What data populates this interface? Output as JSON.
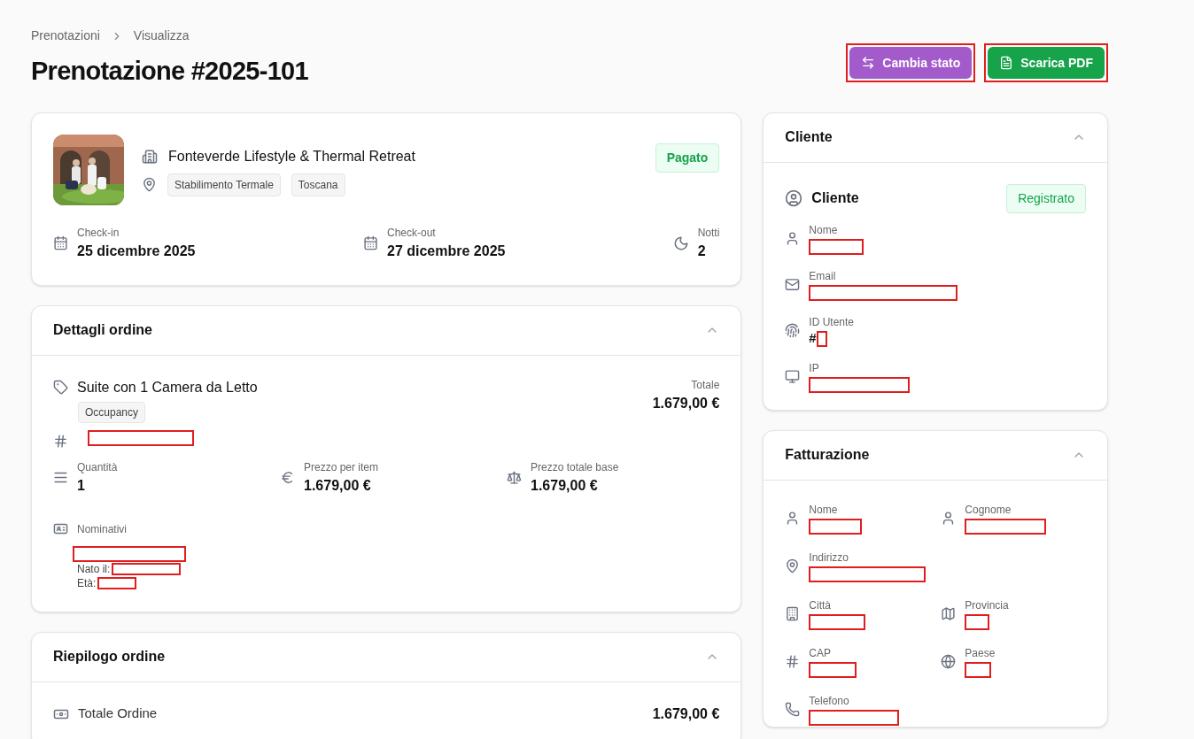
{
  "breadcrumb": [
    {
      "label": "Prenotazioni"
    },
    {
      "label": "Visualizza"
    }
  ],
  "title": "Prenotazione #2025-101",
  "actions": [
    {
      "label": "Cambia stato",
      "kind": "status",
      "highlighted": true
    },
    {
      "label": "Scarica PDF",
      "kind": "pdf",
      "highlighted": true
    }
  ],
  "booking": {
    "property": "Fonteverde Lifestyle & Thermal Retreat",
    "tags": [
      "Stabilimento Termale",
      "Toscana"
    ],
    "status": "Pagato",
    "dates": [
      {
        "label": "Check-in",
        "value": "25 dicembre 2025"
      },
      {
        "label": "Check-out",
        "value": "27 dicembre 2025"
      },
      {
        "label": "Notti",
        "value": "2"
      }
    ]
  },
  "order_details": {
    "title": "Dettagli ordine",
    "expanded": true,
    "item": "Suite con 1 Camera da Letto",
    "badge": "Occupancy",
    "code_redacted": true,
    "total_label": "Totale",
    "total": "1.679,00 €",
    "stats": [
      {
        "label": "Quantità",
        "value": "1"
      },
      {
        "label": "Prezzo per item",
        "value": "1.679,00 €"
      },
      {
        "label": "Prezzo totale base",
        "value": "1.679,00 €"
      }
    ],
    "guests_label": "Nominativi",
    "guest_name_redacted": true,
    "guest_lines": [
      {
        "label": "Nato il:",
        "redacted": true
      },
      {
        "label": "Età:",
        "redacted": true
      }
    ]
  },
  "order_summary": {
    "title": "Riepilogo ordine",
    "expanded": true,
    "rows": [
      {
        "label": "Totale Ordine",
        "value": "1.679,00 €"
      }
    ]
  },
  "customer": {
    "title": "Cliente",
    "expanded": true,
    "heading": "Cliente",
    "badge": "Registrato",
    "fields": [
      {
        "label": "Nome",
        "redacted": true
      },
      {
        "label": "Email",
        "redacted": true
      },
      {
        "label": "ID Utente",
        "value": "#",
        "redacted": true
      },
      {
        "label": "IP",
        "redacted": true
      }
    ]
  },
  "billing": {
    "title": "Fatturazione",
    "expanded": true,
    "rows": [
      [
        {
          "label": "Nome",
          "redacted": true
        },
        {
          "label": "Cognome",
          "redacted": true
        }
      ],
      [
        {
          "label": "Indirizzo",
          "redacted": true
        }
      ],
      [
        {
          "label": "Città",
          "redacted": true
        },
        {
          "label": "Provincia",
          "redacted": true
        }
      ],
      [
        {
          "label": "CAP",
          "redacted": true
        },
        {
          "label": "Paese",
          "redacted": true
        }
      ],
      [
        {
          "label": "Telefono",
          "redacted": true
        }
      ]
    ]
  }
}
